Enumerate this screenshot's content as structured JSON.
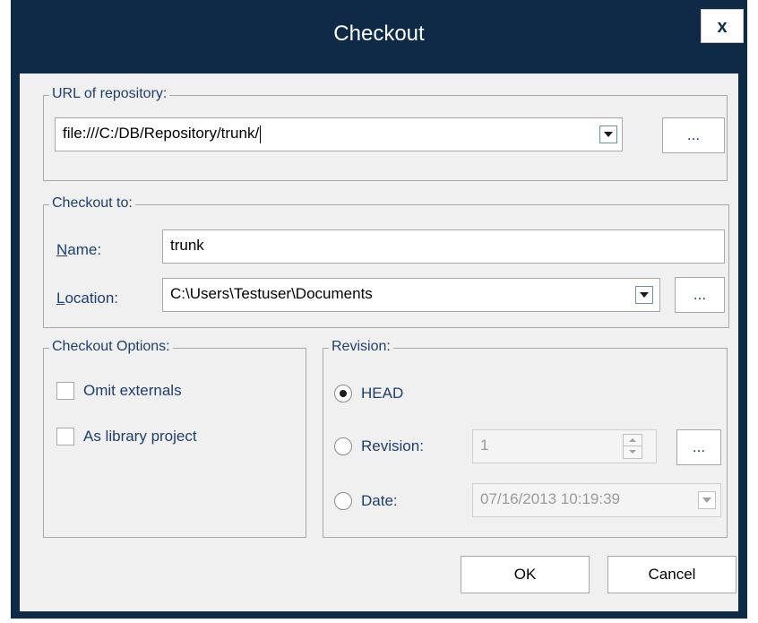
{
  "window": {
    "title": "Checkout",
    "close_glyph": "x"
  },
  "repository": {
    "legend": "URL of repository:",
    "url_value": "file:///C:/DB/Repository/trunk/",
    "browse_label": "..."
  },
  "checkout_to": {
    "legend": "Checkout to:",
    "name_label": "Name:",
    "name_value": "trunk",
    "location_label": "Location:",
    "location_value": "C:\\Users\\Testuser\\Documents",
    "browse_label": "..."
  },
  "options": {
    "legend": "Checkout Options:",
    "omit_externals": {
      "label": "Omit externals",
      "checked": false
    },
    "library_project": {
      "label": "As library project",
      "checked": false
    }
  },
  "revision": {
    "legend": "Revision:",
    "head_label": "HEAD",
    "revision_label": "Revision:",
    "revision_value": "1",
    "date_label": "Date:",
    "date_value": "07/16/2013 10:19:39",
    "browse_label": "...",
    "selected": "HEAD"
  },
  "footer": {
    "ok_label": "OK",
    "cancel_label": "Cancel"
  },
  "colors": {
    "titlebar": "#0e2a47",
    "label_text": "#1f3f6b",
    "client_bg": "#f0f0f0"
  },
  "icons": [
    "close-icon",
    "chevron-down-icon",
    "spinner-up-icon",
    "spinner-down-icon"
  ]
}
